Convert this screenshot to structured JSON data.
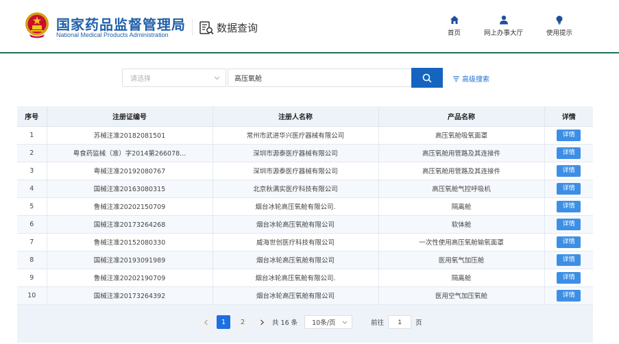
{
  "header": {
    "brand_cn": "国家药品监督管理局",
    "brand_en": "National Medical Products Administration",
    "module_title": "数据查询",
    "nav": [
      {
        "label": "首页",
        "icon": "home-icon"
      },
      {
        "label": "网上办事大厅",
        "icon": "user-icon"
      },
      {
        "label": "使用提示",
        "icon": "lightbulb-icon"
      }
    ]
  },
  "search": {
    "select_placeholder": "请选择",
    "query": "高压氧舱",
    "advanced_label": "高级搜索"
  },
  "table": {
    "columns": [
      "序号",
      "注册证编号",
      "注册人名称",
      "产品名称",
      "详情"
    ],
    "detail_label": "详情",
    "rows": [
      [
        "1",
        "苏械注准20182081501",
        "常州市武进华兴医疗器械有限公司",
        "高压氧舱吸氧面罩"
      ],
      [
        "2",
        "粤食药监械（准）字2014第266078...",
        "深圳市源泰医疗器械有限公司",
        "高压氧舱用管路及其连接件"
      ],
      [
        "3",
        "粤械注准20192080767",
        "深圳市源泰医疗器械有限公司",
        "高压氧舱用管路及其连接件"
      ],
      [
        "4",
        "国械注准20163080315",
        "北京秋满实医疗科技有限公司",
        "高压氧舱气控呼吸机"
      ],
      [
        "5",
        "鲁械注准20202150709",
        "烟台冰轮高压氧舱有限公司.",
        "隔离舱"
      ],
      [
        "6",
        "国械注准20173264268",
        "烟台冰轮高压氧舱有限公司",
        "软体舱"
      ],
      [
        "7",
        "鲁械注准20152080330",
        "威海世创医疗科技有限公司",
        "一次性使用高压氧舱输氧面罩"
      ],
      [
        "8",
        "国械注准20193091989",
        "烟台冰轮高压氧舱有限公司",
        "医用氧气加压舱"
      ],
      [
        "9",
        "鲁械注准20202190709",
        "烟台冰轮高压氧舱有限公司.",
        "隔离舱"
      ],
      [
        "10",
        "国械注准20173264392",
        "烟台冰轮高压氧舱有限公司",
        "医用空气加压氧舱"
      ]
    ]
  },
  "pagination": {
    "pages": [
      "1",
      "2"
    ],
    "current": "1",
    "total_text": "共 16 条",
    "page_size": "10条/页",
    "goto_prefix": "前往",
    "goto_value": "1",
    "goto_suffix": "页"
  },
  "colors": {
    "brand_blue": "#1f5fa8",
    "primary": "#1565c0",
    "accent_line": "#1e6f5a",
    "detail_button": "#3d8fe6"
  }
}
